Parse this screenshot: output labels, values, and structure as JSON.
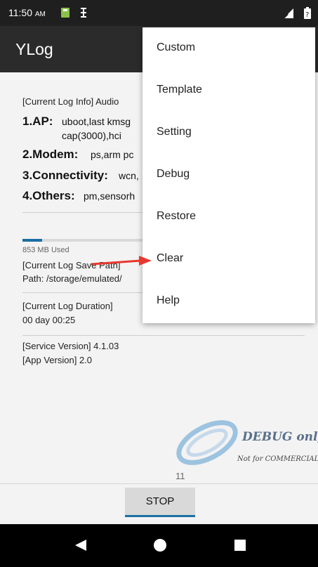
{
  "status_bar": {
    "time": "11:50",
    "ampm": "AM"
  },
  "app": {
    "title": "YLog"
  },
  "log_info": {
    "header": "[Current Log Info] Audio",
    "ap_label": "1.AP:",
    "ap_line1": "uboot,last kmsg",
    "ap_line2": "cap(3000),hci",
    "modem_label": "2.Modem:",
    "modem_value": "ps,arm pc",
    "connectivity_label": "3.Connectivity:",
    "connectivity_value": "wcn,",
    "others_label": "4.Others:",
    "others_value": "pm,sensorh"
  },
  "storage": {
    "used": "853 MB Used",
    "used_fraction": 0.07
  },
  "save_path": {
    "header": "[Current Log Save Path]",
    "path": "Path: /storage/emulated/"
  },
  "duration": {
    "header": "[Current Log Duration]",
    "value": "00 day 00:25"
  },
  "versions": {
    "service": "[Service Version]  4.1.03",
    "app": "[App Version]  2.0"
  },
  "watermark": {
    "title": "DEBUG only",
    "subtitle": "Not for COMMERCIAL"
  },
  "page_number": "11",
  "stop_button": {
    "label": "STOP"
  },
  "menu": {
    "items": [
      "Custom",
      "Template",
      "Setting",
      "Debug",
      "Restore",
      "Clear",
      "Help"
    ]
  },
  "colors": {
    "accent": "#1c6fa3",
    "annotation_arrow": "#e8382f"
  }
}
